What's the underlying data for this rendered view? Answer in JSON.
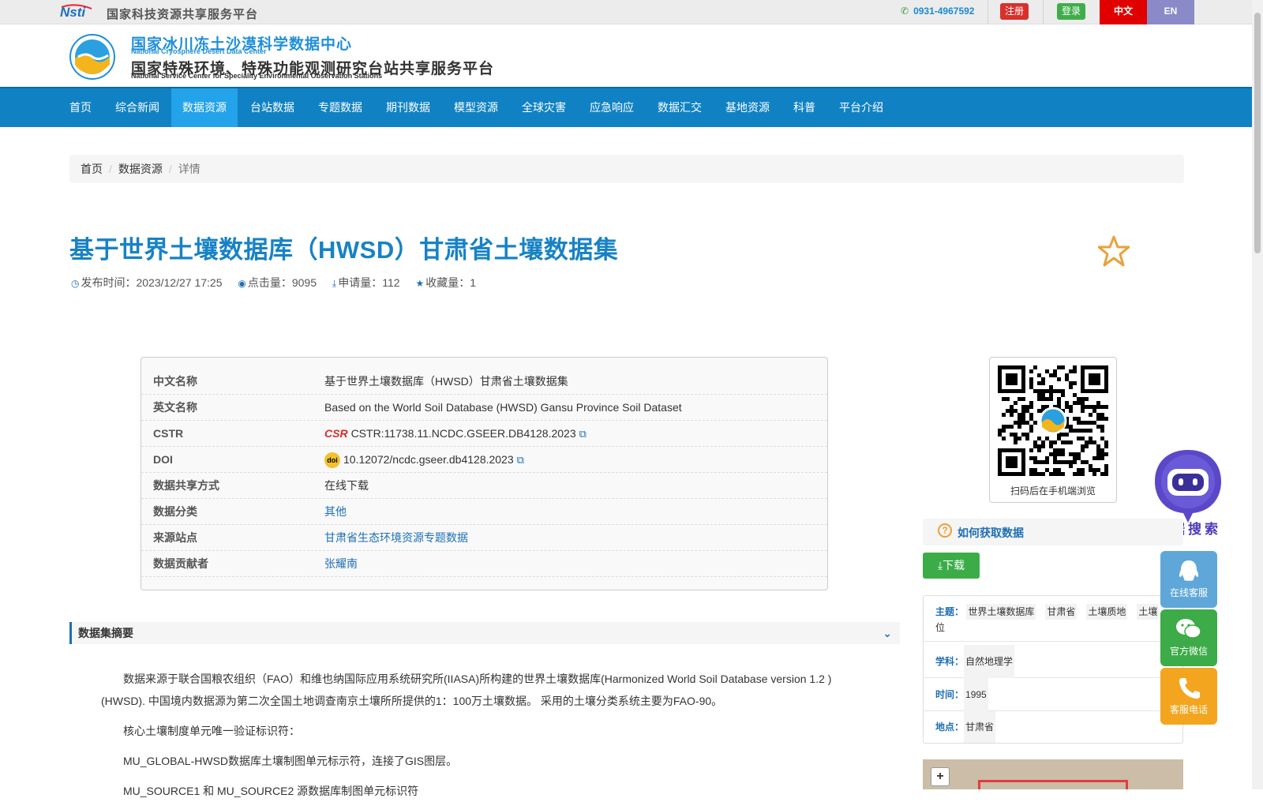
{
  "topbar": {
    "platform_name": "国家科技资源共享服务平台",
    "phone": "0931-4967592",
    "register": "注册",
    "login": "登录",
    "lang_cn": "中文",
    "lang_en": "EN"
  },
  "header": {
    "org_cn": "国家冰川冻土沙漠科学数据中心",
    "org_en": "National Cryosphere Desert Data Center",
    "org2_cn": "国家特殊环境、特殊功能观测研究台站共享服务平台",
    "org2_en": "National Service Center for Speciality Environmental Observation Stations"
  },
  "nav": {
    "items": [
      "首页",
      "综合新闻",
      "数据资源",
      "台站数据",
      "专题数据",
      "期刊数据",
      "模型资源",
      "全球灾害",
      "应急响应",
      "数据汇交",
      "基地资源",
      "科普",
      "平台介绍"
    ],
    "active": "数据资源"
  },
  "breadcrumb": {
    "home": "首页",
    "section": "数据资源",
    "current": "详情"
  },
  "dataset": {
    "title": "基于世界土壤数据库（HWSD）甘肃省土壤数据集",
    "publish_label": "发布时间：",
    "publish_time": "2023/12/27 17:25",
    "views_label": "点击量：",
    "views": "9095",
    "apply_label": "申请量：",
    "apply": "112",
    "fav_label": "收藏量：",
    "fav": "1"
  },
  "info": {
    "cn_name_k": "中文名称",
    "cn_name_v": "基于世界土壤数据库（HWSD）甘肃省土壤数据集",
    "en_name_k": "英文名称",
    "en_name_v": "Based on the World Soil Database (HWSD) Gansu Province Soil Dataset",
    "cstr_k": "CSTR",
    "cstr_v": "CSTR:11738.11.NCDC.GSEER.DB4128.2023",
    "doi_k": "DOI",
    "doi_v": "10.12072/ncdc.gseer.db4128.2023",
    "share_k": "数据共享方式",
    "share_v": "在线下载",
    "cat_k": "数据分类",
    "cat_v": "其他",
    "station_k": "来源站点",
    "station_v": "甘肃省生态环境资源专题数据",
    "contrib_k": "数据贡献者",
    "contrib_v": "张耀南"
  },
  "qr": {
    "caption": "扫码后在手机端浏览"
  },
  "robot": {
    "label": "数据搜索"
  },
  "how": {
    "label": "如何获取数据",
    "download": "下载"
  },
  "tags": {
    "theme_k": "主题：",
    "theme_v": [
      "世界土壤数据库",
      "甘肃省",
      "土壤质地",
      "土壤"
    ],
    "theme_wrap": "位",
    "subject_k": "学科：",
    "subject_v": "自然地理学",
    "time_k": "时间：",
    "time_v": "1995",
    "place_k": "地点：",
    "place_v": "甘肃省"
  },
  "side": {
    "online": "在线客服",
    "wechat": "官方微信",
    "phone": "客服电话"
  },
  "abstract": {
    "heading": "数据集摘要",
    "p1": "数据来源于联合国粮农组织（FAO）和维也纳国际应用系统研究所(IIASA)所构建的世界土壤数据库(Harmonized World Soil Database version 1.2 )",
    "p1b": "(HWSD). 中国境内数据源为第二次全国土地调查南京土壤所所提供的1：100万土壤数据。 采用的土壤分类系统主要为FAO-90。",
    "p2": "核心土壤制度单元唯一验证标识符：",
    "p3": "MU_GLOBAL-HWSD数据库土壤制图单元标示符，连接了GIS图层。",
    "p4": "MU_SOURCE1 和 MU_SOURCE2 源数据库制图单元标识符"
  },
  "colors": {
    "nav": "#1082c4",
    "nav_active": "#23a3ea",
    "title": "#1782c5",
    "link": "#1e6fb4"
  }
}
